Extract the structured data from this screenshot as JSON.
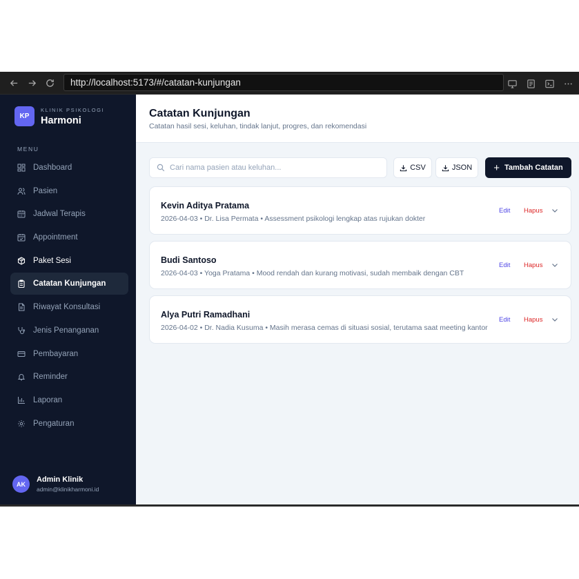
{
  "browser": {
    "url": "http://localhost:5173/#/catatan-kunjungan",
    "icons": [
      "back-arrow-icon",
      "forward-arrow-icon",
      "reload-icon",
      "screen-share-icon",
      "reading-list-icon",
      "terminal-icon",
      "more-icon"
    ]
  },
  "brand": {
    "logo": "KP",
    "subtitle": "KLINIK PSIKOLOGI",
    "name": "Harmoni"
  },
  "sidebar": {
    "menu_label": "MENU",
    "items": [
      {
        "label": "Dashboard",
        "icon": "dashboard-icon"
      },
      {
        "label": "Pasien",
        "icon": "users-icon"
      },
      {
        "label": "Jadwal Terapis",
        "icon": "calendar-icon"
      },
      {
        "label": "Appointment",
        "icon": "calendar-check-icon"
      },
      {
        "label": "Paket Sesi",
        "icon": "package-icon"
      },
      {
        "label": "Catatan Kunjungan",
        "icon": "clipboard-icon"
      },
      {
        "label": "Riwayat Konsultasi",
        "icon": "file-text-icon"
      },
      {
        "label": "Jenis Penanganan",
        "icon": "stethoscope-icon"
      },
      {
        "label": "Pembayaran",
        "icon": "credit-card-icon"
      },
      {
        "label": "Reminder",
        "icon": "bell-icon"
      },
      {
        "label": "Laporan",
        "icon": "bar-chart-icon"
      },
      {
        "label": "Pengaturan",
        "icon": "gear-icon"
      }
    ],
    "active": "Catatan Kunjungan"
  },
  "user": {
    "initials": "AK",
    "name": "Admin Klinik",
    "email": "admin@klinikharmoni.id"
  },
  "header": {
    "title": "Catatan Kunjungan",
    "subtitle": "Catatan hasil sesi, keluhan, tindak lanjut, progres, dan rekomendasi"
  },
  "toolbar": {
    "search_placeholder": "Cari nama pasien atau keluhan...",
    "search_value": "",
    "csv_label": "CSV",
    "json_label": "JSON",
    "add_label": "Tambah Catatan",
    "add_symbol": "+"
  },
  "records": [
    {
      "name": "Kevin Aditya Pratama",
      "meta": "2026-04-03 • Dr. Lisa Permata • Assessment psikologi lengkap atas rujukan dokter",
      "edit": "Edit",
      "delete": "Hapus"
    },
    {
      "name": "Budi Santoso",
      "meta": "2026-04-03 • Yoga Pratama • Mood rendah dan kurang motivasi, sudah membaik dengan CBT",
      "edit": "Edit",
      "delete": "Hapus"
    },
    {
      "name": "Alya Putri Ramadhani",
      "meta": "2026-04-02 • Dr. Nadia Kusuma • Masih merasa cemas di situasi sosial, terutama saat meeting kantor",
      "edit": "Edit",
      "delete": "Hapus"
    }
  ],
  "colors": {
    "sidebar_bg": "#0f172a",
    "accent": "#6366f1",
    "active_item": "#1e293b",
    "edit": "#4f46e5",
    "delete": "#dc2626"
  }
}
